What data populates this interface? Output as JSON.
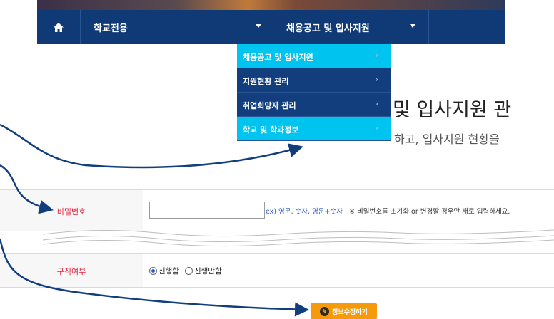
{
  "nav": {
    "home_icon": "home-icon",
    "school_label": "학교전용",
    "recruit_label": "채용공고 및 입사지원"
  },
  "dropdown": {
    "items": [
      {
        "label": "채용공고 및 입사지원",
        "state": "active"
      },
      {
        "label": "지원현황 관리",
        "state": "normal"
      },
      {
        "label": "취업희망자 관리",
        "state": "normal"
      },
      {
        "label": "학교 및 학과정보",
        "state": "highlight"
      }
    ],
    "arrow": "›"
  },
  "page": {
    "title_fragment": "및 입사지원 관",
    "subtitle_fragment": "하고, 입사지원 현황을"
  },
  "form": {
    "password_label": "비밀번호",
    "password_value": "",
    "password_hint_example": "ex) 영문, 숫자, 영문+숫자",
    "password_hint_note": "※ 비밀번호를 초기화 or 변경할 경우만 새로 입력하세요.",
    "job_label": "구직여부",
    "job_options": [
      "진행함",
      "진행안함"
    ],
    "job_selected": "진행함"
  },
  "actions": {
    "save_label": "정보수정하기",
    "save_icon": "pencil-icon"
  },
  "colors": {
    "nav_bg": "#0f3a76",
    "dropdown_active": "#00c4f0",
    "label_red": "#e0243a",
    "button_orange": "#f59a0a",
    "arrow_navy": "#123e7e"
  }
}
